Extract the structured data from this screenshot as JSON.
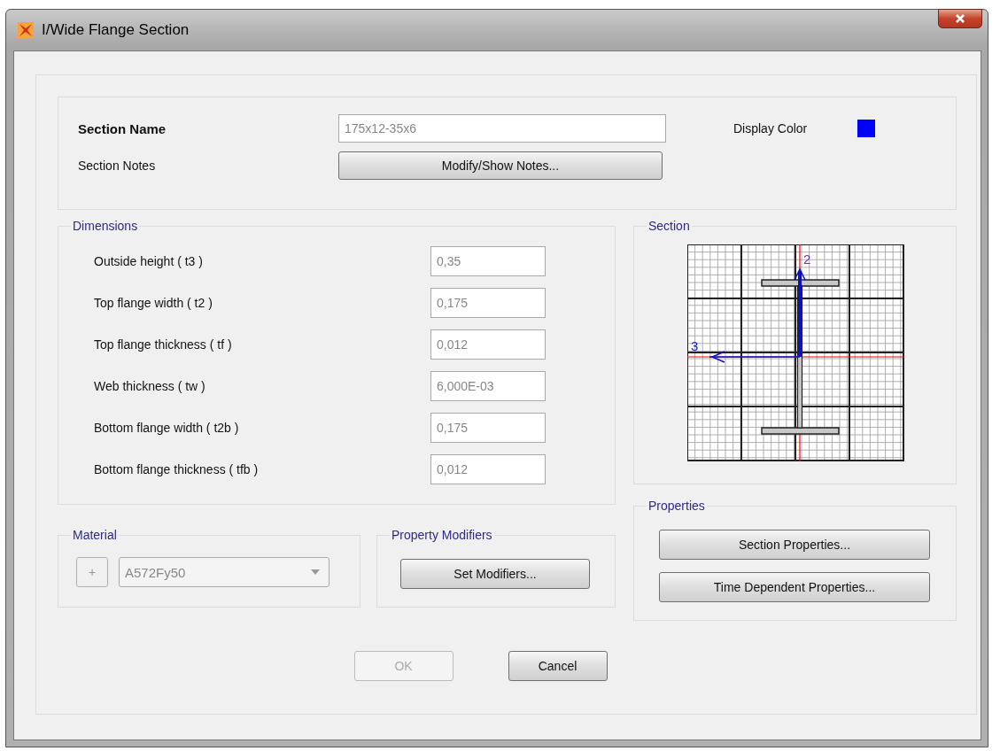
{
  "window": {
    "title": "I/Wide Flange Section"
  },
  "header": {
    "name_label": "Section Name",
    "name_value": "175x12-35x6",
    "name_disabled": true,
    "notes_label": "Section Notes",
    "notes_button": "Modify/Show Notes...",
    "color_label": "Display Color",
    "color": "#0000ff"
  },
  "dimensions": {
    "title": "Dimensions",
    "rows": [
      {
        "label": "Outside height  ( t3 )",
        "value": "0,35",
        "disabled": true
      },
      {
        "label": "Top flange width  ( t2 )",
        "value": "0,175",
        "disabled": true
      },
      {
        "label": "Top flange thickness  ( tf )",
        "value": "0,012",
        "disabled": true
      },
      {
        "label": "Web thickness  ( tw )",
        "value": "6,000E-03",
        "disabled": true
      },
      {
        "label": "Bottom flange width  ( t2b )",
        "value": "0,175",
        "disabled": true
      },
      {
        "label": "Bottom flange thickness  ( tfb )",
        "value": "0,012",
        "disabled": true
      }
    ]
  },
  "section": {
    "title": "Section",
    "axis_2": "2",
    "axis_3": "3"
  },
  "properties": {
    "title": "Properties",
    "buttons": [
      "Section Properties...",
      "Time Dependent Properties..."
    ]
  },
  "material": {
    "title": "Material",
    "add": "+",
    "value": "A572Fy50",
    "disabled": true
  },
  "modifiers": {
    "title": "Property Modifiers",
    "button": "Set Modifiers..."
  },
  "footer": [
    {
      "label": "OK",
      "disabled": true
    },
    {
      "label": "Cancel",
      "disabled": false
    }
  ]
}
